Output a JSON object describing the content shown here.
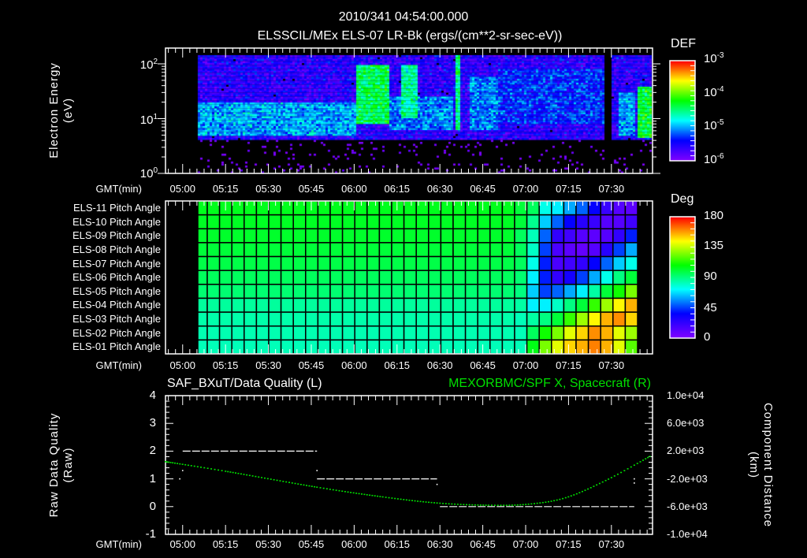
{
  "header": {
    "time": "2010/341 04:54:00.000",
    "subtitle": "ELSSCIL/MEx ELS-07 LR-Bk  (ergs/(cm**2-sr-sec-eV))"
  },
  "colors": {
    "background": "#000000",
    "axes": "#ffffff",
    "orbit_series": "#00e000",
    "quality_series": "#ffffff",
    "colormap": [
      "#7f00ff",
      "#0000ff",
      "#00ffff",
      "#00ff00",
      "#ffff00",
      "#ff0000"
    ]
  },
  "chart_data": [
    {
      "type": "heatmap",
      "panel": "energy-spectrogram",
      "ylabel_line1": "Electron Energy",
      "ylabel_line2": "(eV)",
      "xlabel": "GMT(min)",
      "xlim": [
        "04:54",
        "07:44"
      ],
      "xticks": [
        "05:00",
        "05:15",
        "05:30",
        "05:45",
        "06:00",
        "06:15",
        "06:30",
        "06:45",
        "07:00",
        "07:15",
        "07:30"
      ],
      "yscale": "log",
      "ylim": [
        1,
        145
      ],
      "yticks": [
        {
          "base": "10",
          "exp": "0",
          "value": 1
        },
        {
          "base": "10",
          "exp": "1",
          "value": 10
        },
        {
          "base": "10",
          "exp": "2",
          "value": 100
        }
      ],
      "colorbar": {
        "title": "DEF",
        "scale": "log",
        "range": [
          1e-06,
          0.001
        ],
        "ticks": [
          {
            "base": "10",
            "exp": "-3",
            "value": -3
          },
          {
            "base": "10",
            "exp": "-4",
            "value": -4
          },
          {
            "base": "10",
            "exp": "-5",
            "value": -5
          },
          {
            "base": "10",
            "exp": "-6",
            "value": -6
          }
        ]
      },
      "regions_logDEF": [
        {
          "t": [
            "05:05",
            "07:44"
          ],
          "E": [
            1,
            4
          ],
          "logDEF": -6.3
        },
        {
          "t": [
            "05:05",
            "07:44"
          ],
          "E": [
            4,
            145
          ],
          "logDEF": -5.6
        },
        {
          "t": [
            "05:05",
            "06:00"
          ],
          "E": [
            5,
            20
          ],
          "logDEF": -5.0
        },
        {
          "t": [
            "06:12",
            "06:34"
          ],
          "E": [
            6,
            25
          ],
          "logDEF": -5.1
        },
        {
          "t": [
            "06:00",
            "06:12"
          ],
          "E": [
            8,
            100
          ],
          "logDEF": -4.4
        },
        {
          "t": [
            "06:16",
            "06:22"
          ],
          "E": [
            10,
            100
          ],
          "logDEF": -4.6
        },
        {
          "t": [
            "06:35",
            "06:37"
          ],
          "E": [
            6,
            145
          ],
          "logDEF": -4.5
        },
        {
          "t": [
            "06:40",
            "06:50"
          ],
          "E": [
            6,
            60
          ],
          "logDEF": -5.1
        },
        {
          "t": [
            "06:50",
            "07:27"
          ],
          "E": [
            8,
            80
          ],
          "logDEF": -5.3
        },
        {
          "t": [
            "07:27",
            "07:30"
          ],
          "E": [
            1,
            145
          ],
          "logDEF": -6.9
        },
        {
          "t": [
            "07:32",
            "07:38"
          ],
          "E": [
            5,
            30
          ],
          "logDEF": -5.0
        },
        {
          "t": [
            "07:39",
            "07:44"
          ],
          "E": [
            4.5,
            40
          ],
          "logDEF": -4.3
        }
      ]
    },
    {
      "type": "heatmap",
      "panel": "pitch-angle",
      "xlabel": "GMT(min)",
      "xticks": [
        "05:00",
        "05:15",
        "05:30",
        "05:45",
        "06:00",
        "06:15",
        "06:30",
        "06:45",
        "07:00",
        "07:15",
        "07:30"
      ],
      "x_start": "05:05",
      "x_end": "07:43",
      "colorbar": {
        "title": "Deg",
        "range": [
          0,
          180
        ],
        "ticks": [
          "180",
          "135",
          "90",
          "45",
          "0"
        ]
      },
      "rows": [
        {
          "label": "ELS-11 Pitch Angle",
          "early": 104,
          "late": [
            100,
            95,
            75,
            70,
            60,
            50,
            35,
            20,
            12,
            10
          ]
        },
        {
          "label": "ELS-10 Pitch Angle",
          "early": 103,
          "late": [
            100,
            88,
            65,
            50,
            35,
            25,
            20,
            12,
            12,
            18
          ]
        },
        {
          "label": "ELS-09 Pitch Angle",
          "early": 102,
          "late": [
            95,
            82,
            50,
            22,
            18,
            12,
            10,
            12,
            22,
            40
          ]
        },
        {
          "label": "ELS-08 Pitch Angle",
          "early": 100,
          "late": [
            95,
            80,
            45,
            15,
            10,
            8,
            12,
            25,
            45,
            60
          ]
        },
        {
          "label": "ELS-07 Pitch Angle",
          "early": 98,
          "late": [
            95,
            75,
            40,
            15,
            18,
            22,
            35,
            50,
            65,
            75
          ]
        },
        {
          "label": "ELS-06 Pitch Angle",
          "early": 95,
          "late": [
            92,
            70,
            40,
            22,
            30,
            45,
            60,
            75,
            90,
            100
          ]
        },
        {
          "label": "ELS-05 Pitch Angle",
          "early": 92,
          "late": [
            90,
            65,
            45,
            50,
            60,
            70,
            85,
            100,
            110,
            125
          ]
        },
        {
          "label": "ELS-04 Pitch Angle",
          "early": 86,
          "late": [
            85,
            70,
            70,
            80,
            90,
            100,
            115,
            130,
            145,
            155
          ]
        },
        {
          "label": "ELS-03 Pitch Angle",
          "early": 84,
          "late": [
            82,
            85,
            90,
            100,
            115,
            130,
            145,
            155,
            160,
            150
          ]
        },
        {
          "label": "ELS-02 Pitch Angle",
          "early": 83,
          "late": [
            82,
            95,
            110,
            125,
            140,
            150,
            160,
            155,
            140,
            130
          ]
        },
        {
          "label": "ELS-01 Pitch Angle",
          "early": 82,
          "late": [
            82,
            105,
            125,
            140,
            150,
            155,
            162,
            155,
            140,
            120
          ]
        }
      ]
    },
    {
      "type": "line",
      "panel": "data-quality-orbit",
      "title_left": "SAF_BXuT/Data Quality (L)",
      "title_right": "MEXORBMC/SPF X, Spacecraft (R)",
      "ylabel_left_line1": "Raw Data Quality",
      "ylabel_left_line2": "(Raw)",
      "ylabel_right_line1": "Component Distance",
      "ylabel_right_line2": "(km)",
      "xlabel": "GMT(min)",
      "xticks": [
        "05:00",
        "05:15",
        "05:30",
        "05:45",
        "06:00",
        "06:15",
        "06:30",
        "06:45",
        "07:00",
        "07:15",
        "07:30"
      ],
      "ylim_left": [
        -1,
        4
      ],
      "yticks_left": [
        "4",
        "3",
        "2",
        "1",
        "0",
        "-1"
      ],
      "ylim_right": [
        -10000,
        10000
      ],
      "yticks_right": [
        "1.0e+04",
        "6.0e+03",
        "2.0e+03",
        "-2.0e+03",
        "-6.0e+03",
        "-1.0e+04"
      ],
      "series": [
        {
          "name": "SAF_BXuT/Data Quality",
          "axis": "left",
          "segments": [
            {
              "t": [
                "05:00",
                "05:47"
              ],
              "value": 2
            },
            {
              "t": [
                "05:47",
                "06:29"
              ],
              "value": 1
            },
            {
              "t": [
                "06:30",
                "07:38"
              ],
              "value": 0
            }
          ],
          "points": [
            {
              "t": "04:59",
              "value": 1.0
            },
            {
              "t": "05:00",
              "value": 1.3
            },
            {
              "t": "05:47",
              "value": 1.3
            },
            {
              "t": "06:29",
              "value": 0.8
            },
            {
              "t": "07:38",
              "value": 1.0
            },
            {
              "t": "07:38",
              "value": 0.85
            }
          ]
        },
        {
          "name": "MEXORBMC/SPF X, Spacecraft",
          "axis": "right",
          "t": [
            "04:54",
            "05:15",
            "05:47",
            "06:10",
            "06:29",
            "06:47",
            "07:01",
            "07:14",
            "07:28",
            "07:44"
          ],
          "km": [
            480,
            -900,
            -3200,
            -4600,
            -5480,
            -5800,
            -5650,
            -4720,
            -2240,
            1360
          ]
        }
      ]
    }
  ]
}
